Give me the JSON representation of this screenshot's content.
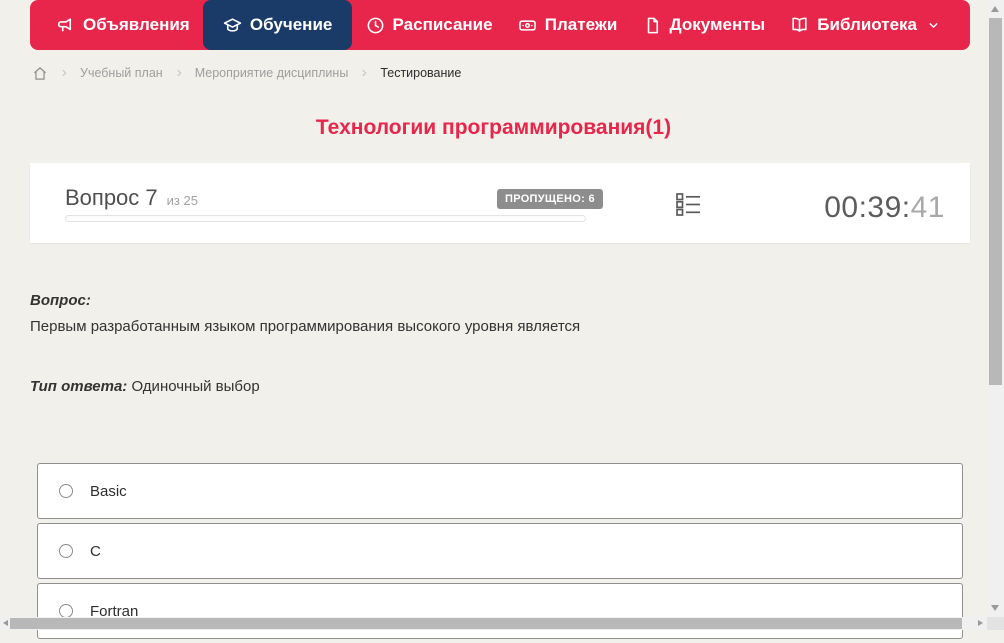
{
  "nav": {
    "items": [
      {
        "label": "Объявления",
        "icon": "megaphone-icon",
        "active": false
      },
      {
        "label": "Обучение",
        "icon": "graduation-cap-icon",
        "active": true
      },
      {
        "label": "Расписание",
        "icon": "clock-icon",
        "active": false
      },
      {
        "label": "Платежи",
        "icon": "banknote-icon",
        "active": false
      },
      {
        "label": "Документы",
        "icon": "document-icon",
        "active": false
      },
      {
        "label": "Библиотека",
        "icon": "book-icon",
        "active": false,
        "has_dropdown": true,
        "dropdown_icon": "chevron-down-icon"
      }
    ]
  },
  "breadcrumb": {
    "home_icon": "home-icon",
    "items": [
      {
        "label": "Учебный план",
        "current": false
      },
      {
        "label": "Мероприятие дисциплины",
        "current": false
      },
      {
        "label": "Тестирование",
        "current": true
      }
    ]
  },
  "page": {
    "title": "Технологии программирования(1)"
  },
  "quiz": {
    "question_number_label": "Вопрос 7",
    "question_of_label": "из 25",
    "skipped_badge": "ПРОПУЩЕНО: 6",
    "progress_percent": 0,
    "question_list_icon": "question-list-icon",
    "timer": {
      "main": "00:39:",
      "seconds": "41"
    },
    "question_heading": "Вопрос:",
    "question_text": "Первым разработанным языком программирования высокого уровня является",
    "answer_type_label": "Тип ответа:",
    "answer_type_value": "Одиночный выбор",
    "options": [
      {
        "label": "Basic",
        "selected": false
      },
      {
        "label": "C",
        "selected": false
      },
      {
        "label": "Fortran",
        "selected": false
      }
    ]
  },
  "colors": {
    "accent_red": "#e8264c",
    "active_navy": "#1a3a68",
    "page_background": "#f2f0ea",
    "badge_gray": "#8d8d8d"
  }
}
